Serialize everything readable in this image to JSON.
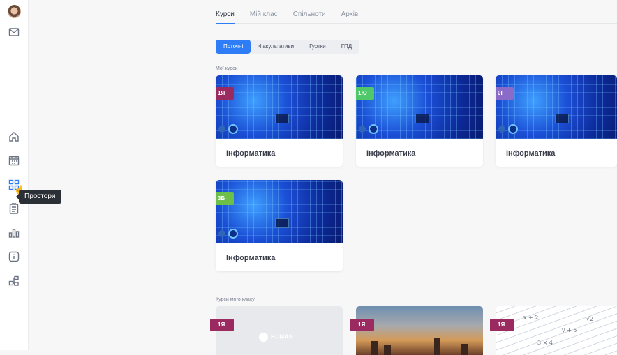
{
  "sidebar": {
    "tooltip": "Простори"
  },
  "tabs": [
    "Курси",
    "Мій клас",
    "Спільноти",
    "Архів"
  ],
  "subtabs": [
    "Поточні",
    "Факультативи",
    "Гуртки",
    "ГПД"
  ],
  "sections": {
    "my_courses": "Мої курси",
    "class_courses": "Курси мого класу"
  },
  "my_courses": [
    {
      "badge": "1Я",
      "title": "Інформатика",
      "badge_color": "#9b2a61"
    },
    {
      "badge": "1Ю",
      "title": "Інформатика",
      "badge_color": "#4fc86a"
    },
    {
      "badge": "0Г",
      "title": "Інформатика",
      "badge_color": "#8a6bc9"
    },
    {
      "badge": "3Б",
      "title": "Інформатика",
      "badge_color": "#6cc04a"
    }
  ],
  "class_courses": [
    {
      "badge": "1Я",
      "logo": "HUMAN",
      "badge_color": "#9b2a61"
    },
    {
      "badge": "1Я",
      "badge_color": "#9b2a61"
    },
    {
      "badge": "1Я",
      "badge_color": "#9b2a61"
    }
  ],
  "colors": {
    "accent": "#2f7df6"
  }
}
